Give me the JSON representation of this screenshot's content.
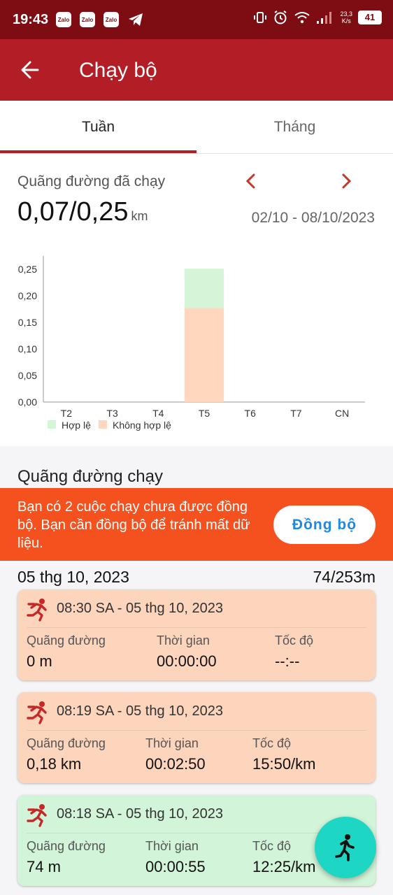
{
  "status_bar": {
    "time": "19:43",
    "apps": [
      "Zalo",
      "Zalo",
      "Zalo"
    ],
    "net_speed_value": "23,3",
    "net_speed_unit": "K/s",
    "battery": "41"
  },
  "app_bar": {
    "title": "Chạy bộ"
  },
  "tabs": [
    {
      "label": "Tuần",
      "active": true
    },
    {
      "label": "Tháng",
      "active": false
    }
  ],
  "summary": {
    "label": "Quãng đường đã chạy",
    "value": "0,07/0,25",
    "unit": "km",
    "date_range": "02/10 - 08/10/2023"
  },
  "chart_data": {
    "type": "bar",
    "stacked": true,
    "categories": [
      "T2",
      "T3",
      "T4",
      "T5",
      "T6",
      "T7",
      "CN"
    ],
    "series": [
      {
        "name": "Không hợp lệ",
        "color": "#ffd7be",
        "values": [
          0,
          0,
          0,
          0.177,
          0,
          0,
          0
        ]
      },
      {
        "name": "Hợp lệ",
        "color": "#d4f5d8",
        "values": [
          0,
          0,
          0,
          0.074,
          0,
          0,
          0
        ]
      }
    ],
    "yticks": [
      "0,00",
      "0,05",
      "0,10",
      "0,15",
      "0,20",
      "0,25"
    ],
    "ylim": [
      0,
      0.25
    ],
    "legend": [
      "Hợp lệ",
      "Không hợp lệ"
    ],
    "legend_position": "bottom-left"
  },
  "runs_section": {
    "title": "Quãng đường chạy",
    "sync_banner": {
      "message": "Bạn có 2 cuộc chạy chưa được đồng bộ. Bạn cần đồng bộ để tránh mất dữ liệu.",
      "button": "Đồng bộ"
    },
    "day": {
      "date": "05 thg 10, 2023",
      "total": "74/253m"
    },
    "labels": {
      "distance": "Quãng đường",
      "time": "Thời gian",
      "pace": "Tốc độ"
    },
    "runs": [
      {
        "time": "08:30 SA - 05 thg 10, 2023",
        "distance": "0 m",
        "duration": "00:00:00",
        "pace": "--:--",
        "status": "invalid"
      },
      {
        "time": "08:19 SA - 05 thg 10, 2023",
        "distance": "0,18 km",
        "duration": "00:02:50",
        "pace": "15:50/km",
        "status": "invalid"
      },
      {
        "time": "08:18 SA - 05 thg 10, 2023",
        "distance": "74 m",
        "duration": "00:00:55",
        "pace": "12:25/km",
        "status": "valid"
      }
    ]
  },
  "colors": {
    "status_bar": "#7d0d12",
    "app_bar": "#b31d26",
    "banner": "#f4511e",
    "invalid_card": "#fdd5bd",
    "valid_card": "#d2f5d9",
    "fab": "#1dd6c4",
    "run_icon": "#c62828"
  },
  "icons": {
    "back": "arrow-left-icon",
    "prev": "chevron-left-icon",
    "next": "chevron-right-icon",
    "run": "runner-icon",
    "fab": "walking-person-icon"
  }
}
